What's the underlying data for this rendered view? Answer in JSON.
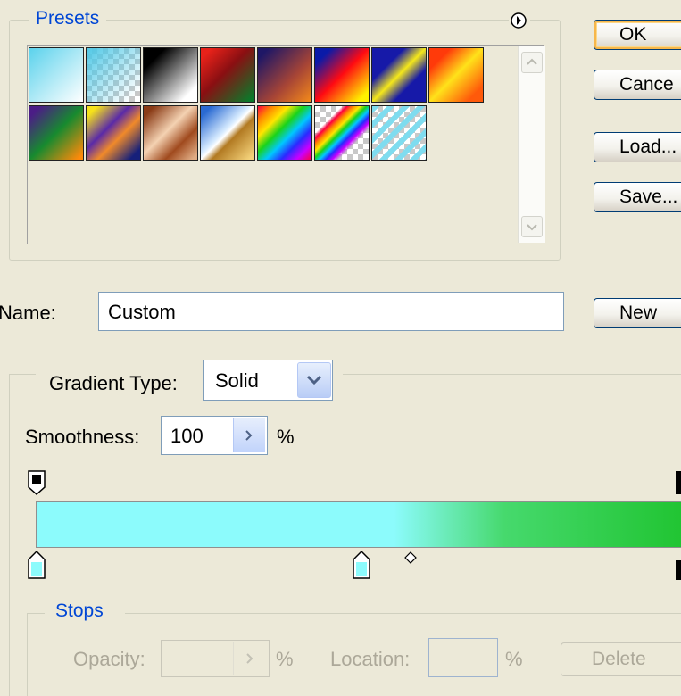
{
  "presets": {
    "legend": "Presets",
    "menu_icon": "circle-arrow-right-icon",
    "swatches_row1": [
      {
        "name": "cyan-white-gradient",
        "style": "linear-gradient(135deg,#5bd2ec 0%,#ffffff 100%)"
      },
      {
        "name": "cyan-transparent-gradient",
        "style": "checker-cyan"
      },
      {
        "name": "black-white-gradient",
        "style": "linear-gradient(135deg,#000 20%,#fff 85%)"
      },
      {
        "name": "red-green-gradient",
        "style": "linear-gradient(135deg,#e8221a 10%,#8a0f12 45%,#0a7a2a 95%)"
      },
      {
        "name": "violet-orange-gradient",
        "style": "linear-gradient(135deg,#1f1766 10%,#a64436 60%,#f58b1a 100%)"
      },
      {
        "name": "blue-red-yellow-gradient",
        "style": "linear-gradient(135deg,#0a1aa8 15%,#ff0a12 50%,#fff200 90%)"
      },
      {
        "name": "blue-yellow-blue-gradient",
        "style": "linear-gradient(135deg,#1619a8 30%,#f5e81a 50%,#1619a8 70%)"
      },
      {
        "name": "orange-yellow-orange-gradient",
        "style": "linear-gradient(135deg,#ff3a0a 20%,#ffe21a 50%,#ff5a0a 85%)"
      }
    ],
    "swatches_row2": [
      {
        "name": "violet-green-orange-gradient",
        "style": "linear-gradient(135deg,#4b1d86 10%,#178a2f 50%,#ff8a0a 95%)"
      },
      {
        "name": "yellow-violet-orange-gradient",
        "style": "linear-gradient(135deg,#f6e21a 10%,#5a2aa8 40%,#f08a2a 60%,#16207a 90%)"
      },
      {
        "name": "copper-gradient",
        "style": "linear-gradient(135deg,#8a3b16 10%,#f4d2b2 45%,#a04a1e 70%,#e0ac84 95%)"
      },
      {
        "name": "chrome-gradient",
        "style": "linear-gradient(135deg,#2a6ad2 10%,#d8ecff 45%,#ffffff 50%,#b27a22 60%,#f4d27a 95%)"
      },
      {
        "name": "spectrum-gradient",
        "style": "linear-gradient(135deg,#ff0040,#ff8a00,#ffe600,#1ad31a,#00c8ff,#2a2aff,#c800ff,#ff0040)"
      },
      {
        "name": "transparent-rainbow-gradient",
        "style": "checker-rainbow"
      },
      {
        "name": "transparent-stripes-gradient",
        "style": "checker-stripes"
      }
    ],
    "scroll_up_icon": "chevron-up-icon",
    "scroll_down_icon": "chevron-down-icon"
  },
  "buttons": {
    "ok": "OK",
    "cancel": "Cance",
    "load": "Load...",
    "save": "Save...",
    "new": "New"
  },
  "name_row": {
    "label": "Name:",
    "value": "Custom"
  },
  "gradient_type": {
    "label": "Gradient Type:",
    "value": "Solid",
    "dropdown_icon": "chevron-down-icon"
  },
  "smoothness": {
    "label": "Smoothness:",
    "value": "100",
    "unit": "%",
    "arrow_icon": "arrow-right-icon"
  },
  "gradient_bar": {
    "color_start": "#8cfbfc",
    "color_end": "#20c431",
    "transition_start_pct": 55,
    "transition_end_pct": 100,
    "opacity_stop_icon": "opacity-stop-icon",
    "color_stop_icon": "color-stop-icon",
    "midpoint_icon": "diamond-midpoint-icon",
    "color_stop_positions_pct": [
      0,
      50,
      100
    ],
    "midpoint_position_pct": 57
  },
  "stops": {
    "legend": "Stops",
    "opacity_label": "Opacity:",
    "opacity_unit": "%",
    "location_label": "Location:",
    "location_unit": "%",
    "delete_label": "Delete"
  }
}
